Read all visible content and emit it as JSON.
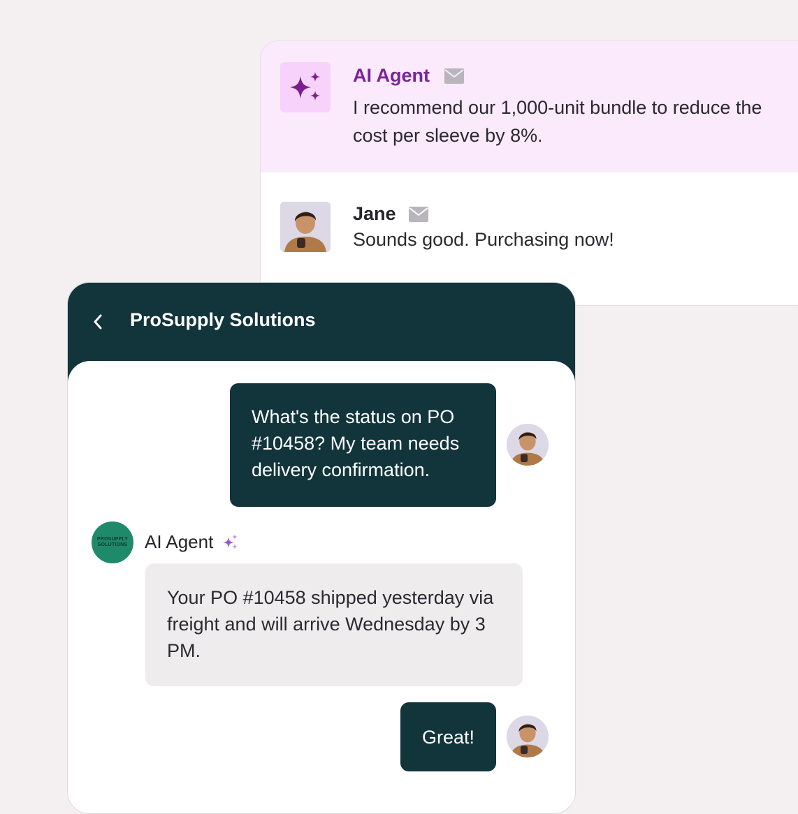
{
  "thread": {
    "ai_message": {
      "sender": "AI Agent",
      "text": "I recommend our 1,000-unit bundle to reduce the cost per sleeve by 8%."
    },
    "jane_message": {
      "sender": "Jane",
      "text": "Sounds good. Purchasing now!"
    }
  },
  "chat": {
    "title": "ProSupply Solutions",
    "back_icon": "chevron-left-icon",
    "messages": [
      {
        "from": "user",
        "text": "What's the status on PO #10458? My team needs delivery confirmation."
      },
      {
        "from": "agent",
        "sender": "AI Agent",
        "text": "Your PO #10458 shipped yesterday via freight and will arrive Wednesday by 3 PM."
      },
      {
        "from": "user",
        "text": "Great!"
      }
    ],
    "bot_logo": [
      "PROSUPPLY",
      "SOLUTIONS"
    ]
  },
  "colors": {
    "header_bg": "#12343b",
    "ai_row_bg": "#fbe9fc",
    "ai_name": "#7b2399",
    "bot_avatar": "#1e8a6a",
    "agent_bubble": "#efecee"
  }
}
